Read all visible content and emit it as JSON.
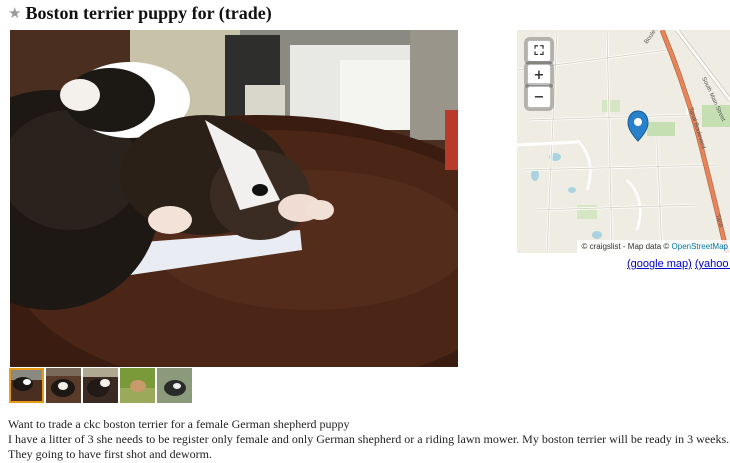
{
  "posting": {
    "title": "Boston terrier puppy for (trade)",
    "star_icon": "star-icon"
  },
  "gallery": {
    "thumbnail_count": 5,
    "selected_index": 0
  },
  "map": {
    "road_label_1": "Boulevard",
    "road_label_2": "South Main Street",
    "road_label_3": "Tanal Boulevard",
    "road_label_4": "Tana",
    "attribution": "© craigslist - Map data ©",
    "attribution_link": "OpenStreetMap",
    "google_link": "(google map)",
    "yahoo_link": "(yahoo map)",
    "marker_icon": "map-pin-icon",
    "accent_color": "#e8845a",
    "pin_color": "#2a81cb"
  },
  "body": {
    "line1": "Want to trade a ckc boston terrier for a female German shepherd puppy",
    "line2": "I have a litter of 3 she needs to be register only female and only German shepherd or a riding lawn mower. My boston terrier will be ready in 3 weeks.",
    "line3": "They going to have first shot and deworm."
  }
}
